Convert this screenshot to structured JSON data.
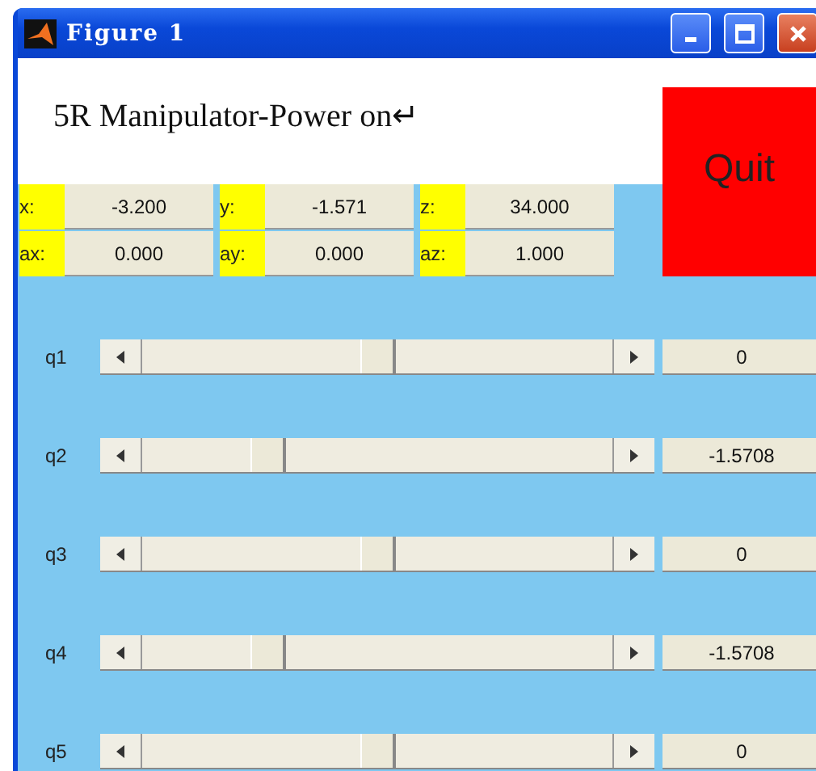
{
  "window": {
    "title": "Figure 1"
  },
  "heading": "5R Manipulator-Power on↵",
  "quit_button": "Quit",
  "fields": [
    {
      "label": "x:",
      "value": "-3.200"
    },
    {
      "label": "y:",
      "value": "-1.571"
    },
    {
      "label": "z:",
      "value": "34.000"
    },
    {
      "label": "ax:",
      "value": "0.000"
    },
    {
      "label": "ay:",
      "value": "0.000"
    },
    {
      "label": "az:",
      "value": "1.000"
    }
  ],
  "joints": [
    {
      "label": "q1",
      "level": 0.5,
      "value": "0"
    },
    {
      "label": "q2",
      "level": 0.25,
      "value": "-1.5708"
    },
    {
      "label": "q3",
      "level": 0.5,
      "value": "0"
    },
    {
      "label": "q4",
      "level": 0.25,
      "value": "-1.5708"
    },
    {
      "label": "q5",
      "level": 0.5,
      "value": "0"
    }
  ]
}
